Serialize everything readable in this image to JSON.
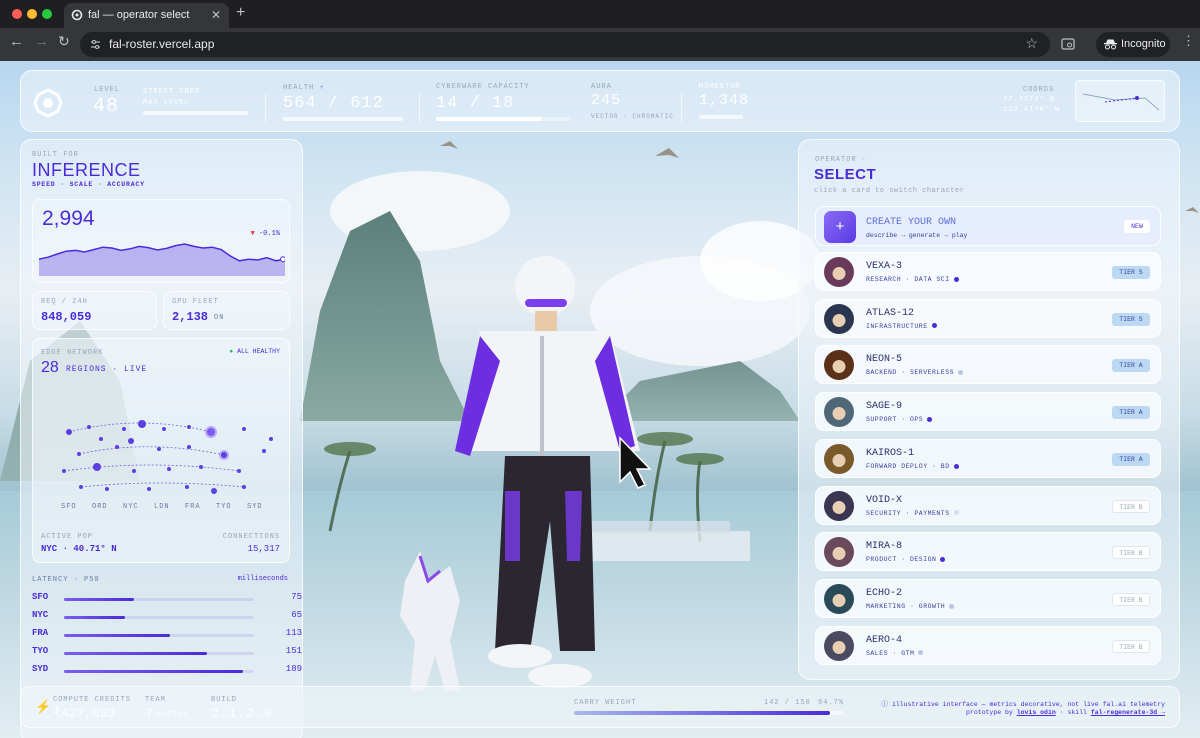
{
  "browser": {
    "tab_title": "fal — operator select",
    "url": "fal-roster.vercel.app",
    "incognito_label": "Incognito"
  },
  "hud": {
    "level_label": "LEVEL",
    "level_value": "48",
    "street_cred_label": "STREET CRED",
    "max_level_label": "MAX LEVEL",
    "health_label": "HEALTH",
    "health_value": "564 / 612",
    "cyberware_label": "CYBERWARE CAPACITY",
    "cyberware_value": "14 / 18",
    "aura_label": "AURA",
    "aura_value": "245",
    "aura_sub": "VECTOR · CHROMATIC",
    "momentum_label": "MOMENTUM",
    "momentum_value": "1,348",
    "coords_label": "COORDS",
    "coords_lat": "37.7774° N",
    "coords_lon": "122.4170° W"
  },
  "inference": {
    "built_for": "BUILT FOR",
    "title": "INFERENCE",
    "tags": "SPEED · SCALE · ACCURACY",
    "throughput_value": "2,994",
    "delta": "▼ -0.1%",
    "sparkline": [
      0.42,
      0.47,
      0.55,
      0.62,
      0.64,
      0.6,
      0.66,
      0.72,
      0.7,
      0.64,
      0.68,
      0.74,
      0.71,
      0.65,
      0.69,
      0.76,
      0.8,
      0.74,
      0.7,
      0.72,
      0.66,
      0.5,
      0.38,
      0.42,
      0.4,
      0.46,
      0.38,
      0.42
    ],
    "req_label": "REQ / 24H",
    "req_value": "848,059",
    "gpu_label": "GPU FLEET",
    "gpu_value": "2,138",
    "gpu_unit": "ON"
  },
  "edge": {
    "label": "EDGE NETWORK",
    "health": "ALL HEALTHY",
    "regions_count": "28",
    "regions_text": "REGIONS · LIVE",
    "cities": [
      "SFO",
      "ORD",
      "NYC",
      "LDN",
      "FRA",
      "TYO",
      "SYD"
    ],
    "active_label": "ACTIVE PoP",
    "active_value": "NYC · 40.71° N",
    "connections_label": "CONNECTIONS",
    "connections_value": "15,317"
  },
  "latency": {
    "label": "LATENCY · P50",
    "unit": "milliseconds",
    "rows": [
      {
        "city": "SFO",
        "value": "75",
        "fill": 0.37
      },
      {
        "city": "NYC",
        "value": "65",
        "fill": 0.32
      },
      {
        "city": "FRA",
        "value": "113",
        "fill": 0.56
      },
      {
        "city": "TYO",
        "value": "151",
        "fill": 0.75
      },
      {
        "city": "SYD",
        "value": "189",
        "fill": 0.94
      }
    ]
  },
  "operator": {
    "kicker": "OPERATOR ·",
    "title": "SELECT",
    "hint": "click a card to switch character",
    "create_title": "CREATE YOUR OWN",
    "create_sub": "describe → generate → play",
    "create_badge": "NEW",
    "list": [
      {
        "name": "VEXA-3",
        "role": "RESEARCH · DATA SCI",
        "tier": "TIER S",
        "dot": "#4b2bd8",
        "skin": "#6a3a5a"
      },
      {
        "name": "ATLAS-12",
        "role": "INFRASTRUCTURE",
        "tier": "TIER S",
        "dot": "#4b2bd8",
        "skin": "#2a3550"
      },
      {
        "name": "NEON-5",
        "role": "BACKEND · SERVERLESS",
        "tier": "TIER A",
        "dot": "#b9c4e8",
        "skin": "#5a3018"
      },
      {
        "name": "SAGE-9",
        "role": "SUPPORT · OPS",
        "tier": "TIER A",
        "dot": "#4b2bd8",
        "skin": "#4f6878"
      },
      {
        "name": "KAIROS-1",
        "role": "FORWARD DEPLOY · BD",
        "tier": "TIER A",
        "dot": "#4b2bd8",
        "skin": "#7a5a2a"
      },
      {
        "name": "VOID-X",
        "role": "SECURITY · PAYMENTS",
        "tier": "TIER B",
        "dot": "#d6dcef",
        "skin": "#3a3550"
      },
      {
        "name": "MIRA-8",
        "role": "PRODUCT · DESIGN",
        "tier": "TIER B",
        "dot": "#4b2bd8",
        "skin": "#6a4a5a"
      },
      {
        "name": "ECHO-2",
        "role": "MARKETING · GROWTH",
        "tier": "TIER B",
        "dot": "#b9c4e8",
        "skin": "#2a4a5a"
      },
      {
        "name": "AERO-4",
        "role": "SALES · GTM",
        "tier": "TIER B",
        "dot": "#b9c4e8",
        "skin": "#4a4a60"
      }
    ]
  },
  "footer": {
    "credits_label": "COMPUTE CREDITS",
    "credits_value": "₹427,893",
    "team_label": "TEAM",
    "team_value": "7",
    "team_unit": "ACTIVE",
    "build_label": "BUILD",
    "build_value": "2.1.2.0",
    "carry_label": "CARRY WEIGHT",
    "carry_value": "142 / 150",
    "carry_pct": "94.7%",
    "carry_fill": 0.947,
    "disclaimer": "ⓘ illustrative interface — metrics decorative, not live fal.ai telemetry",
    "credit_prefix": "prototype by",
    "credit_name": "lovis odin",
    "skill_prefix": "· skill",
    "skill_name": "fal-regenerate-3d →"
  },
  "colors": {
    "accent": "#4b2bd8",
    "tier_s_bg": "#bcd9f3",
    "tier_b_bg": "#ffffff"
  }
}
